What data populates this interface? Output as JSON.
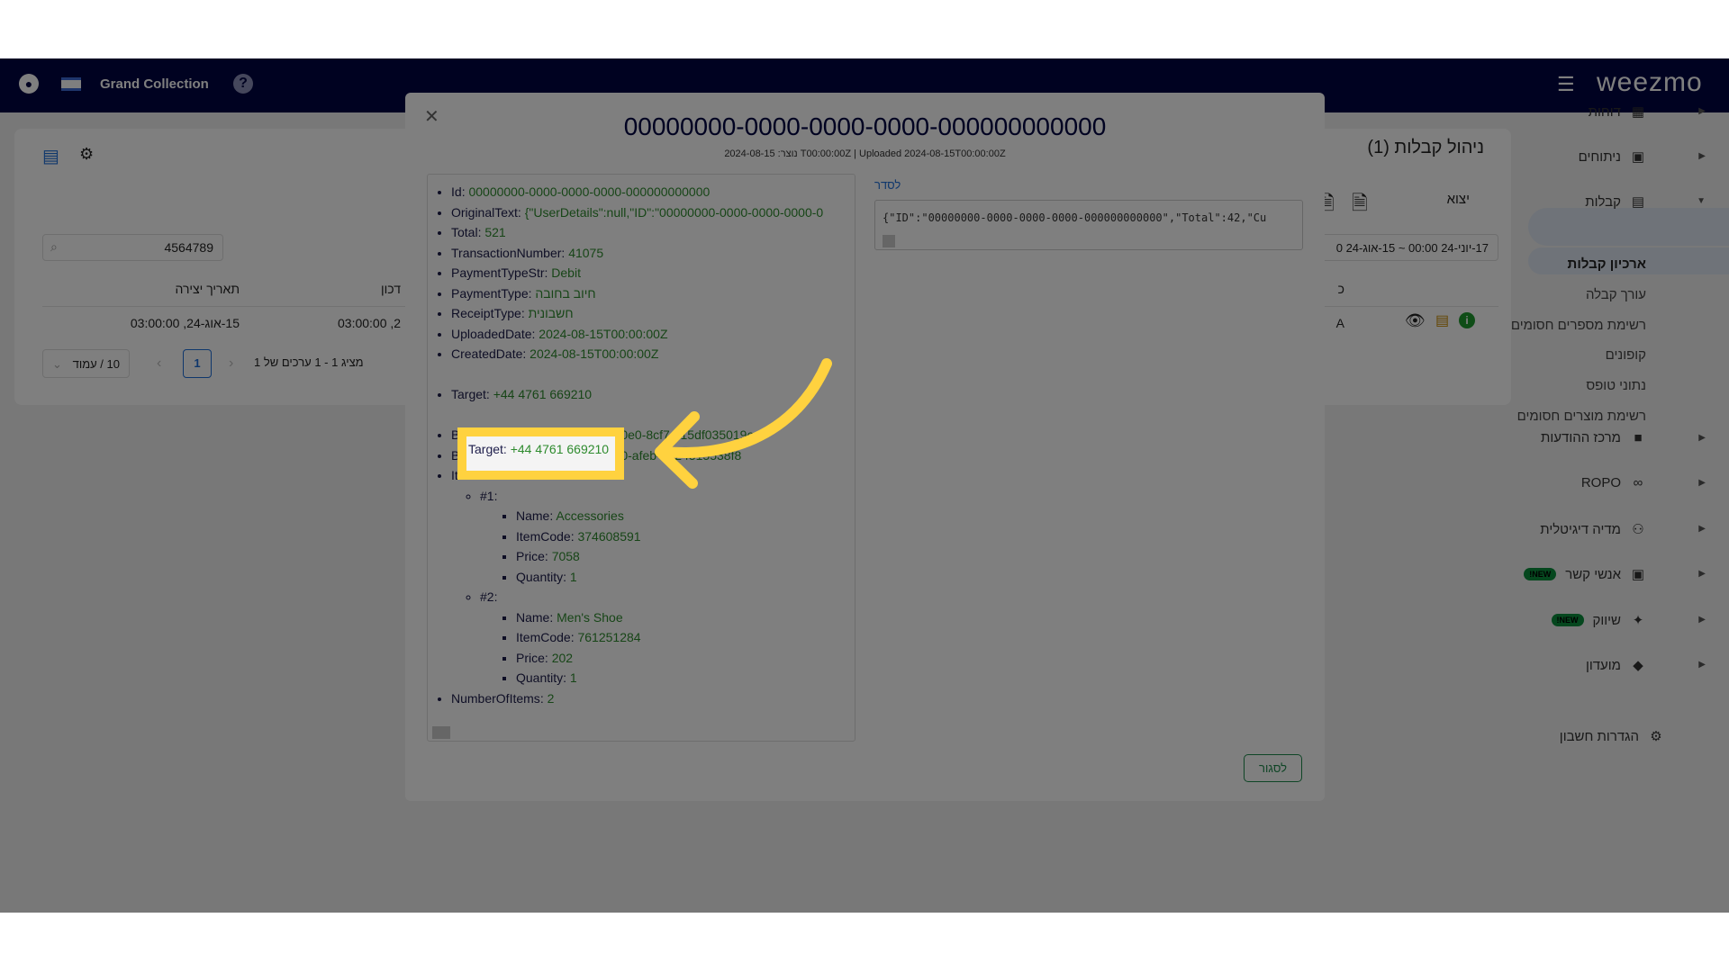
{
  "nav": {
    "brand": "Grand Collection",
    "logo": "weezmo",
    "icons": [
      "user-icon",
      "israel-flag-icon",
      "help-icon",
      "menu-icon"
    ]
  },
  "sidebar": {
    "items": [
      {
        "label": "דוחות",
        "icon": "dashboard-icon"
      },
      {
        "label": "ניתוחים",
        "icon": "analytics-icon"
      },
      {
        "label": "קבלות",
        "icon": "receipt-icon",
        "expanded": true
      },
      {
        "label": "מרכז ההודעות",
        "icon": "chat-icon"
      },
      {
        "label": "ROPO",
        "icon": "infinity-icon"
      },
      {
        "label": "מדיה דיגיטלית",
        "icon": "group-icon"
      },
      {
        "label": "אנשי קשר",
        "icon": "contacts-icon",
        "badge": "NEW!"
      },
      {
        "label": "שיווק",
        "icon": "party-icon",
        "badge": "NEW!"
      },
      {
        "label": "מועדון",
        "icon": "tag-icon"
      }
    ],
    "subitems": [
      "ארכיון קבלות",
      "עורך קבלה",
      "רשימת מספרים חסומים",
      "קופונים",
      "נתוני טופס",
      "רשימת מוצרים חסומים"
    ],
    "settings": "הגדרות חשבון"
  },
  "page": {
    "title": "ניהול קבלות (1)",
    "export_label": "יצוא",
    "date_range": "17-יוני-24 00:00 ~ 15-אוג-24 0",
    "search_value": "4564789",
    "columns": [
      "תאריך יצירה",
      "דכון",
      "כ"
    ],
    "row": [
      "15-אוג-24, 03:00:00",
      "03:00:00 ,2",
      "A"
    ],
    "pagination": {
      "summary": "מציג 1 - 1 ערכים של 1",
      "current": "1",
      "page_size": "10 / עמוד"
    }
  },
  "modal": {
    "title": "00000000-0000-0000-0000-000000000000",
    "subtitle": "2024-08-15 :נוצר T00:00:00Z | Uploaded 2024-08-15T00:00:00Z",
    "fields": [
      {
        "k": "Id",
        "v": "00000000-0000-0000-0000-000000000000"
      },
      {
        "k": "OriginalText",
        "v": "{\"UserDetails\":null,\"ID\":\"00000000-0000-0000-0000-0"
      },
      {
        "k": "Total",
        "v": "521"
      },
      {
        "k": "TransactionNumber",
        "v": "41075"
      },
      {
        "k": "PaymentTypeStr",
        "v": "Debit"
      },
      {
        "k": "PaymentType",
        "v": "חיוב בחובה"
      },
      {
        "k": "ReceiptType",
        "v": "חשבונית"
      },
      {
        "k": "UploadedDate",
        "v": "2024-08-15T00:00:00Z"
      },
      {
        "k": "CreatedDate",
        "v": "2024-08-15T00:00:00Z"
      }
    ],
    "target": {
      "k": "Target",
      "v": "+44 4761 669210"
    },
    "fields2": [
      {
        "k": "BusinessID",
        "v": "0130c670-67d4-40e0-8cf7-c15df035019e"
      },
      {
        "k": "BranchID",
        "v": "49a54d2a-fad5-4470-afeb-0224515538f8"
      }
    ],
    "items_label": "Items",
    "items": [
      {
        "n": "#1",
        "Name": "Accessories",
        "ItemCode": "374608591",
        "Price": "7058",
        "Quantity": "1"
      },
      {
        "n": "#2",
        "Name": "Men's Shoe",
        "ItemCode": "761251284",
        "Price": "202",
        "Quantity": "1"
      }
    ],
    "number_of_items": {
      "k": "NumberOfItems",
      "v": "2"
    },
    "json_label": "לסדר",
    "json_text": "{\"ID\":\"00000000-0000-0000-0000-000000000000\",\"Total\":42,\"Cu",
    "close_label": "לסגור"
  },
  "colors": {
    "nav": "#000542",
    "highlight": "#ffd23f",
    "value": "#2e8b2e",
    "accent": "#0a8f3c"
  }
}
